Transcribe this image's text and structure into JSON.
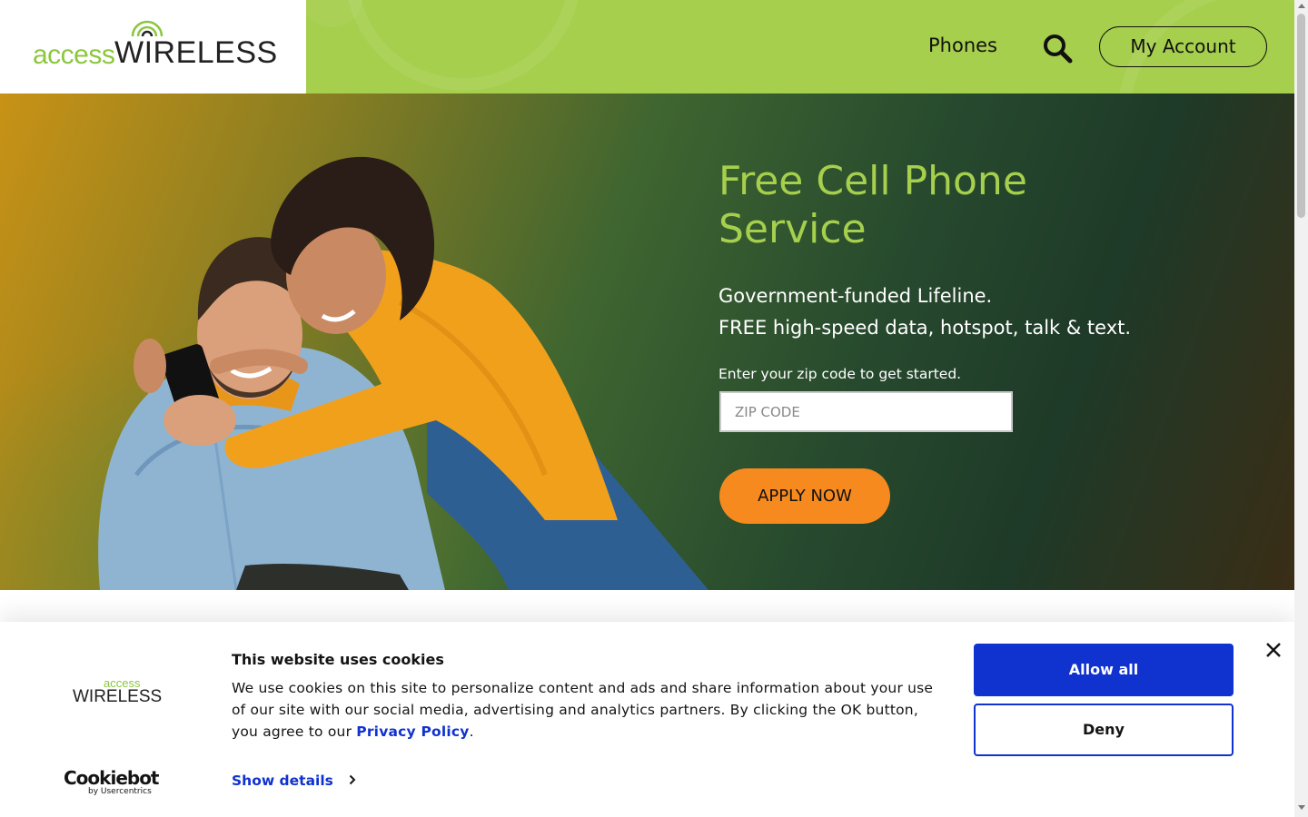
{
  "header": {
    "logo_access": "access",
    "logo_wireless": "WIRELESS",
    "nav_phones": "Phones",
    "search_icon": "search-icon",
    "my_account": "My Account"
  },
  "hero": {
    "title": "Free Cell Phone Service",
    "subtitle_line1": "Government-funded Lifeline.",
    "subtitle_line2": "FREE high-speed data, hotspot, talk & text.",
    "zip_label": "Enter your zip code to get started.",
    "zip_placeholder": "ZIP CODE",
    "apply_label": "APPLY NOW",
    "image": "couple-looking-at-phone-photo"
  },
  "cookie_banner": {
    "logo_access": "access",
    "logo_wireless": "WIRELESS",
    "title": "This website uses cookies",
    "text_before_link": "We use cookies on this site to personalize content and ads and share information about your use of our site with our social media, advertising and analytics partners. By clicking the OK button, you agree to our ",
    "link_text": "Privacy Policy",
    "text_after_link": ".",
    "show_details": "Show details",
    "allow_all": "Allow all",
    "deny": "Deny",
    "cookiebot_main": "Cookiebot",
    "cookiebot_by": "by Usercentrics"
  },
  "colors": {
    "brand_green": "#a5cf4c",
    "apply_orange": "#f68a1e",
    "cookie_blue": "#1032cf"
  }
}
